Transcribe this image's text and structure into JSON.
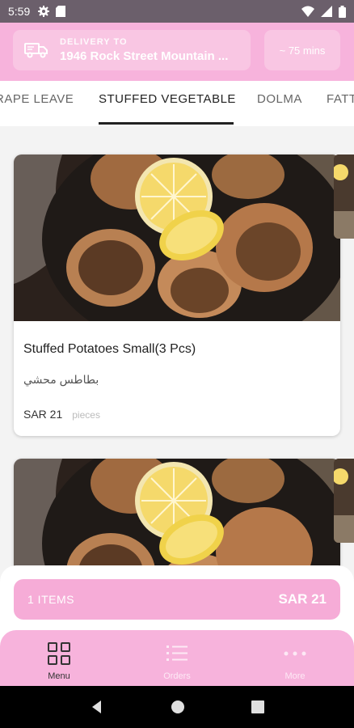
{
  "status_bar": {
    "time": "5:59",
    "left_icons": [
      "gear-icon",
      "sd-card-icon"
    ],
    "right_icons": [
      "wifi-icon",
      "signal-icon",
      "battery-icon"
    ]
  },
  "header": {
    "delivery_label": "DELIVERY TO",
    "address": "1946 Rock Street Mountain ...",
    "eta": "~ 75 mins",
    "icon": "delivery-truck-icon"
  },
  "tabs": [
    {
      "label": "RAPE LEAVE"
    },
    {
      "label": "STUFFED VEGETABLE",
      "active": true
    },
    {
      "label": "DOLMA"
    },
    {
      "label": "FATT"
    }
  ],
  "products": [
    {
      "title": "Stuffed Potatoes Small(3 Pcs)",
      "arabic_name": "بطاطس محشي",
      "price": "SAR 21",
      "unit": "pieces"
    }
  ],
  "cart": {
    "items": "1 ITEMS",
    "total": "SAR 21"
  },
  "bottom_nav": [
    {
      "label": "Menu",
      "icon": "grid-icon",
      "active": true
    },
    {
      "label": "Orders",
      "icon": "list-icon"
    },
    {
      "label": "More",
      "icon": "more-dots-icon"
    }
  ],
  "system_nav": [
    "back-icon",
    "home-icon",
    "recents-icon"
  ],
  "colors": {
    "brand_pink": "#f7b3dc",
    "cart_pink": "#f6acd7",
    "status_bar": "#6b5f6b"
  }
}
